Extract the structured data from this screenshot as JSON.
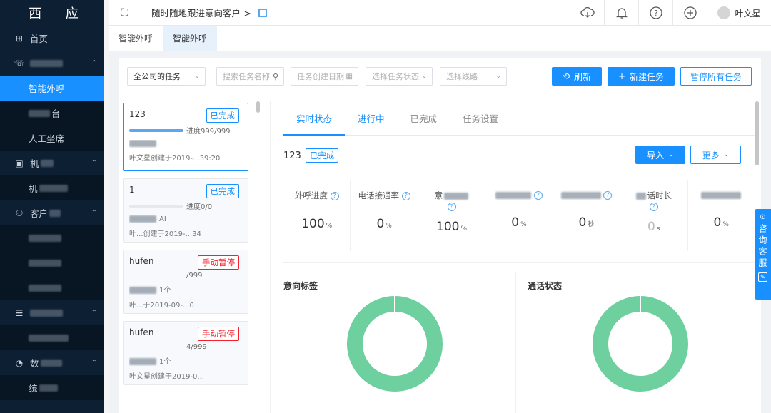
{
  "sidebar": {
    "logo": "西 应",
    "items": [
      {
        "label": "首页",
        "icon": "grid-icon"
      },
      {
        "label": "",
        "icon": "phone-icon"
      },
      {
        "label": "智能外呼",
        "icon": ""
      },
      {
        "label": "台",
        "icon": ""
      },
      {
        "label": "人工坐席",
        "icon": ""
      },
      {
        "label": "机",
        "icon": "robot-icon"
      },
      {
        "label": "机",
        "icon": ""
      },
      {
        "label": "客户",
        "icon": "users-icon"
      },
      {
        "label": "",
        "icon": ""
      },
      {
        "label": "",
        "icon": ""
      },
      {
        "label": "",
        "icon": ""
      },
      {
        "label": "",
        "icon": "sliders-icon"
      },
      {
        "label": "",
        "icon": ""
      },
      {
        "label": "数",
        "icon": "pie-icon"
      },
      {
        "label": "统",
        "icon": ""
      }
    ]
  },
  "topbar": {
    "breadcrumb": "随时随地跟进意向客户->",
    "user_name": "叶文星"
  },
  "tabs": [
    {
      "label": "智能外呼"
    },
    {
      "label": "智能外呼"
    }
  ],
  "toolbar": {
    "scope_select": "全公司的任务",
    "search_placeholder": "搜索任务名称",
    "date_placeholder": "任务创建日期",
    "status_placeholder": "选择任务状态",
    "line_placeholder": "选择线路",
    "refresh_label": "刷新",
    "new_task_label": "新建任务",
    "pause_all_label": "暂停所有任务"
  },
  "tasks": [
    {
      "name": "123",
      "status": "已完成",
      "status_color": "#1890ff",
      "progress_text": "进度999/999",
      "progress": 1.0,
      "line1": "",
      "line2": "叶文星创建于2019-...39:20"
    },
    {
      "name": "1",
      "status": "已完成",
      "status_color": "#1890ff",
      "progress_text": "进度0/0",
      "progress": 0.0,
      "line1": "AI",
      "line2": "叶...创建于2019-...34"
    },
    {
      "name": "hufen",
      "status": "手动暂停",
      "status_color": "#f5222d",
      "progress_text": "/999",
      "progress": null,
      "line1": "1个",
      "line2": "叶...于2019-09-...0"
    },
    {
      "name": "hufen",
      "status": "手动暂停",
      "status_color": "#f5222d",
      "progress_text": "4/999",
      "progress": null,
      "line1": "1个",
      "line2": "叶文星创建于2019-0..."
    }
  ],
  "detail": {
    "tabs": [
      "实时状态",
      "进行中",
      "已完成",
      "任务设置"
    ],
    "task_name": "123",
    "task_status": "已完成",
    "import_label": "导入",
    "more_label": "更多",
    "stats": [
      {
        "label": "外呼进度",
        "value": "100",
        "unit": "%"
      },
      {
        "label": "电话接通率",
        "value": "0",
        "unit": "%"
      },
      {
        "label": "意",
        "value": "100",
        "unit": "%"
      },
      {
        "label": "",
        "value": "0",
        "unit": "%"
      },
      {
        "label": "",
        "value": "0",
        "unit": "秒"
      },
      {
        "label": "话时长",
        "value": "0",
        "unit": "s"
      },
      {
        "label": "",
        "value": "0",
        "unit": "%"
      }
    ],
    "intent_title": "意向标签",
    "call_status_title": "通话状态",
    "chart_color": "#6ecf9f"
  },
  "service": {
    "label": "咨询客服"
  },
  "colors": {
    "primary": "#1890ff",
    "sidebar_bg": "#0d1f33",
    "danger": "#f5222d"
  }
}
